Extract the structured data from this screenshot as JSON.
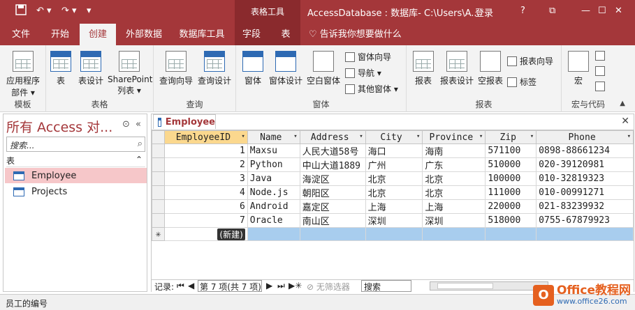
{
  "titlebar": {
    "save_icon": "save-icon",
    "qat_more": "▾",
    "context_group": "表格工具",
    "title": "AccessDatabase : 数据库- C:\\Users\\A...",
    "login": "登录",
    "help": "?",
    "minimize": "—",
    "restore": "☐",
    "close": "✕"
  },
  "tabs": [
    "文件",
    "开始",
    "创建",
    "外部数据",
    "数据库工具",
    "字段",
    "表"
  ],
  "tell_me": "告诉我你想要做什么",
  "ribbon": {
    "groups": [
      {
        "label": "模板",
        "buttons": [
          "应用程序部件 ▾"
        ]
      },
      {
        "label": "表格",
        "buttons": [
          "表",
          "表设计",
          "SharePoint 列表 ▾"
        ]
      },
      {
        "label": "查询",
        "buttons": [
          "查询向导",
          "查询设计"
        ]
      },
      {
        "label": "窗体",
        "buttons": [
          "窗体",
          "窗体设计",
          "空白窗体"
        ],
        "small": [
          "窗体向导",
          "导航 ▾",
          "其他窗体 ▾"
        ]
      },
      {
        "label": "报表",
        "buttons": [
          "报表",
          "报表设计",
          "空报表"
        ],
        "small": [
          "报表向导",
          "标签"
        ]
      },
      {
        "label": "宏与代码",
        "buttons": [
          "宏"
        ]
      }
    ],
    "collapse": "▲"
  },
  "nav": {
    "title": "所有 Access 对...",
    "search_placeholder": "搜索...",
    "category": "表",
    "items": [
      "Employee",
      "Projects"
    ]
  },
  "doc": {
    "tab": "Employee",
    "columns": [
      "EmployeeID",
      "Name",
      "Address",
      "City",
      "Province",
      "Zip",
      "Phone"
    ],
    "rows": [
      [
        "1",
        "Maxsu",
        "人民大道58号",
        "海口",
        "海南",
        "571100",
        "0898-88661234"
      ],
      [
        "2",
        "Python",
        "中山大道1889",
        "广州",
        "广东",
        "510000",
        "020-39120981"
      ],
      [
        "3",
        "Java",
        "海淀区",
        "北京",
        "北京",
        "100000",
        "010-32819323"
      ],
      [
        "4",
        "Node.js",
        "朝阳区",
        "北京",
        "北京",
        "111000",
        "010-00991271"
      ],
      [
        "6",
        "Android",
        "嘉定区",
        "上海",
        "上海",
        "220000",
        "021-83239932"
      ],
      [
        "7",
        "Oracle",
        "南山区",
        "深圳",
        "深圳",
        "518000",
        "0755-67879923"
      ]
    ],
    "new_marker": "✳",
    "new_label": "(新建)"
  },
  "recbar": {
    "label": "记录:",
    "position": "第 7 项(共 7 项)",
    "filter": "无筛选器",
    "search": "搜索"
  },
  "status": "员工的编号",
  "watermark": {
    "main": "Office教程网",
    "sub": "www.office26.com"
  }
}
